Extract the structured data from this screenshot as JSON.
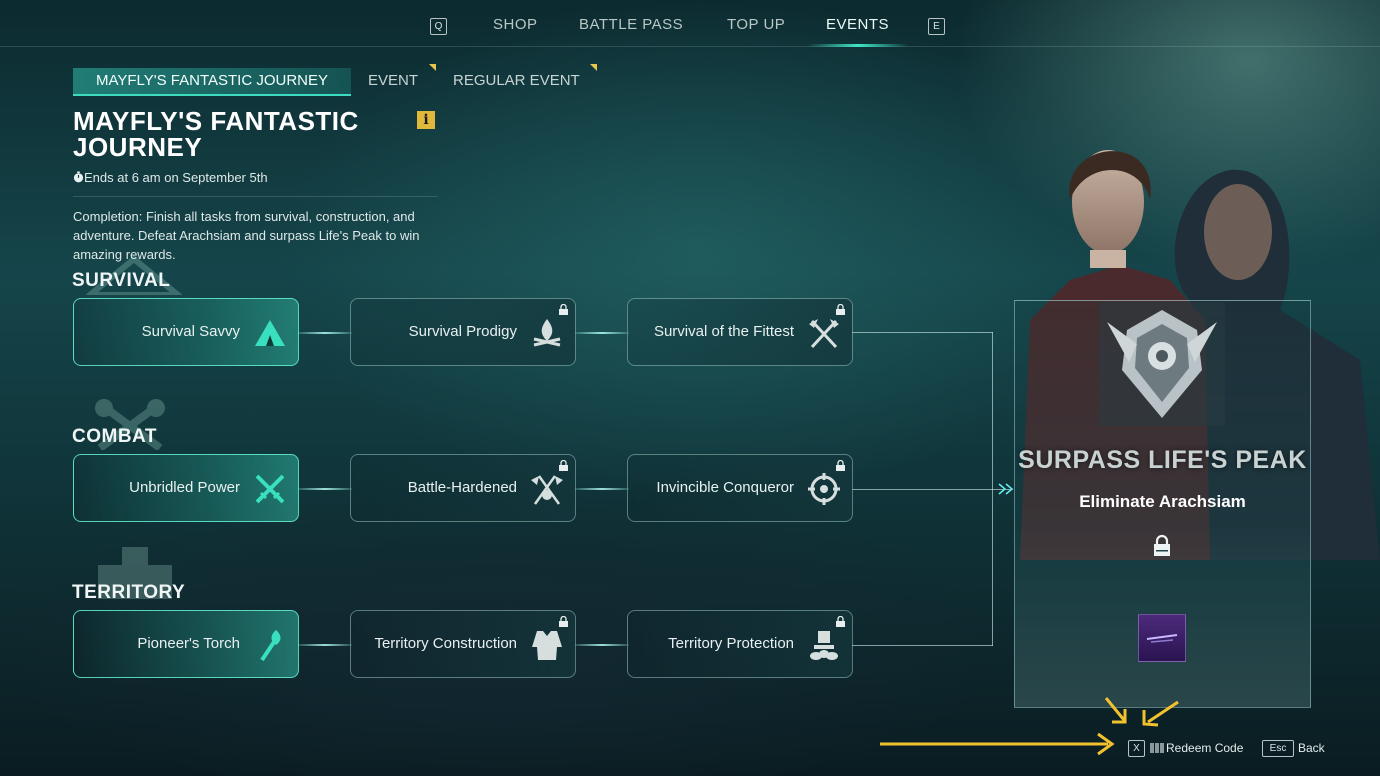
{
  "nav": {
    "left_key": "Q",
    "right_key": "E",
    "tabs": [
      "SHOP",
      "BATTLE PASS",
      "TOP UP",
      "EVENTS"
    ],
    "active": "EVENTS"
  },
  "subtabs": [
    "MAYFLY'S FANTASTIC JOURNEY",
    "EVENT",
    "REGULAR EVENT"
  ],
  "event": {
    "title": "MAYFLY'S FANTASTIC JOURNEY",
    "info_badge": "i",
    "ends": "Ends at 6 am on September 5th",
    "description": "Completion: Finish all tasks from survival, construction, and adventure. Defeat Arachsiam and surpass Life's Peak to win amazing rewards."
  },
  "sections": {
    "survival": {
      "label": "SURVIVAL",
      "tasks": [
        {
          "label": "Survival Savvy",
          "icon": "tent-icon",
          "locked": false
        },
        {
          "label": "Survival Prodigy",
          "icon": "campfire-icon",
          "locked": true
        },
        {
          "label": "Survival of the Fittest",
          "icon": "crossed-axes-icon",
          "locked": true
        }
      ]
    },
    "combat": {
      "label": "COMBAT",
      "tasks": [
        {
          "label": "Unbridled Power",
          "icon": "crossed-swords-icon",
          "locked": false
        },
        {
          "label": "Battle-Hardened",
          "icon": "crossed-flags-icon",
          "locked": true
        },
        {
          "label": "Invincible Conqueror",
          "icon": "crosshair-icon",
          "locked": true
        }
      ]
    },
    "territory": {
      "label": "TERRITORY",
      "tasks": [
        {
          "label": "Pioneer's Torch",
          "icon": "torch-icon",
          "locked": false
        },
        {
          "label": "Territory Construction",
          "icon": "armor-icon",
          "locked": true
        },
        {
          "label": "Territory Protection",
          "icon": "turret-icon",
          "locked": true
        }
      ]
    }
  },
  "final": {
    "title": "SURPASS LIFE'S PEAK",
    "subtitle": "Eliminate Arachsiam",
    "locked": true,
    "emblem": "winged-badge-emblem",
    "reward": "purple-reward-item"
  },
  "bottom": {
    "redeem_key": "X",
    "redeem_label": "Redeem Code",
    "back_key": "Esc",
    "back_label": "Back"
  },
  "colors": {
    "accent": "#3fe6c8",
    "badge": "#e0b83a",
    "annotation_arrow": "#f2c22e"
  }
}
